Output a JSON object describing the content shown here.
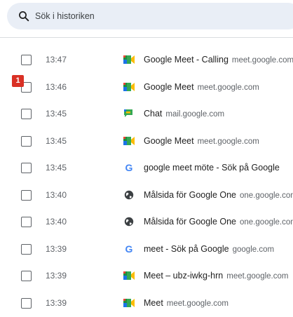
{
  "search": {
    "placeholder": "Sök i historiken"
  },
  "badge": "1",
  "history": [
    {
      "time": "13:47",
      "icon": "google-meet-icon",
      "title": "Google Meet - Calling",
      "domain": "meet.google.com"
    },
    {
      "time": "13:46",
      "icon": "google-meet-icon",
      "title": "Google Meet",
      "domain": "meet.google.com"
    },
    {
      "time": "13:45",
      "icon": "google-chat-icon",
      "title": "Chat",
      "domain": "mail.google.com"
    },
    {
      "time": "13:45",
      "icon": "google-meet-icon",
      "title": "Google Meet",
      "domain": "meet.google.com"
    },
    {
      "time": "13:45",
      "icon": "google-g-icon",
      "title": "google meet möte - Sök på Google",
      "domain": ""
    },
    {
      "time": "13:40",
      "icon": "globe-icon",
      "title": "Målsida för Google One",
      "domain": "one.google.com"
    },
    {
      "time": "13:40",
      "icon": "globe-icon",
      "title": "Målsida för Google One",
      "domain": "one.google.com"
    },
    {
      "time": "13:39",
      "icon": "google-g-icon",
      "title": "meet - Sök på Google",
      "domain": "google.com"
    },
    {
      "time": "13:39",
      "icon": "google-meet-icon",
      "title": "Meet – ubz-iwkg-hrn",
      "domain": "meet.google.com"
    },
    {
      "time": "13:39",
      "icon": "google-meet-icon",
      "title": "Meet",
      "domain": "meet.google.com"
    }
  ]
}
